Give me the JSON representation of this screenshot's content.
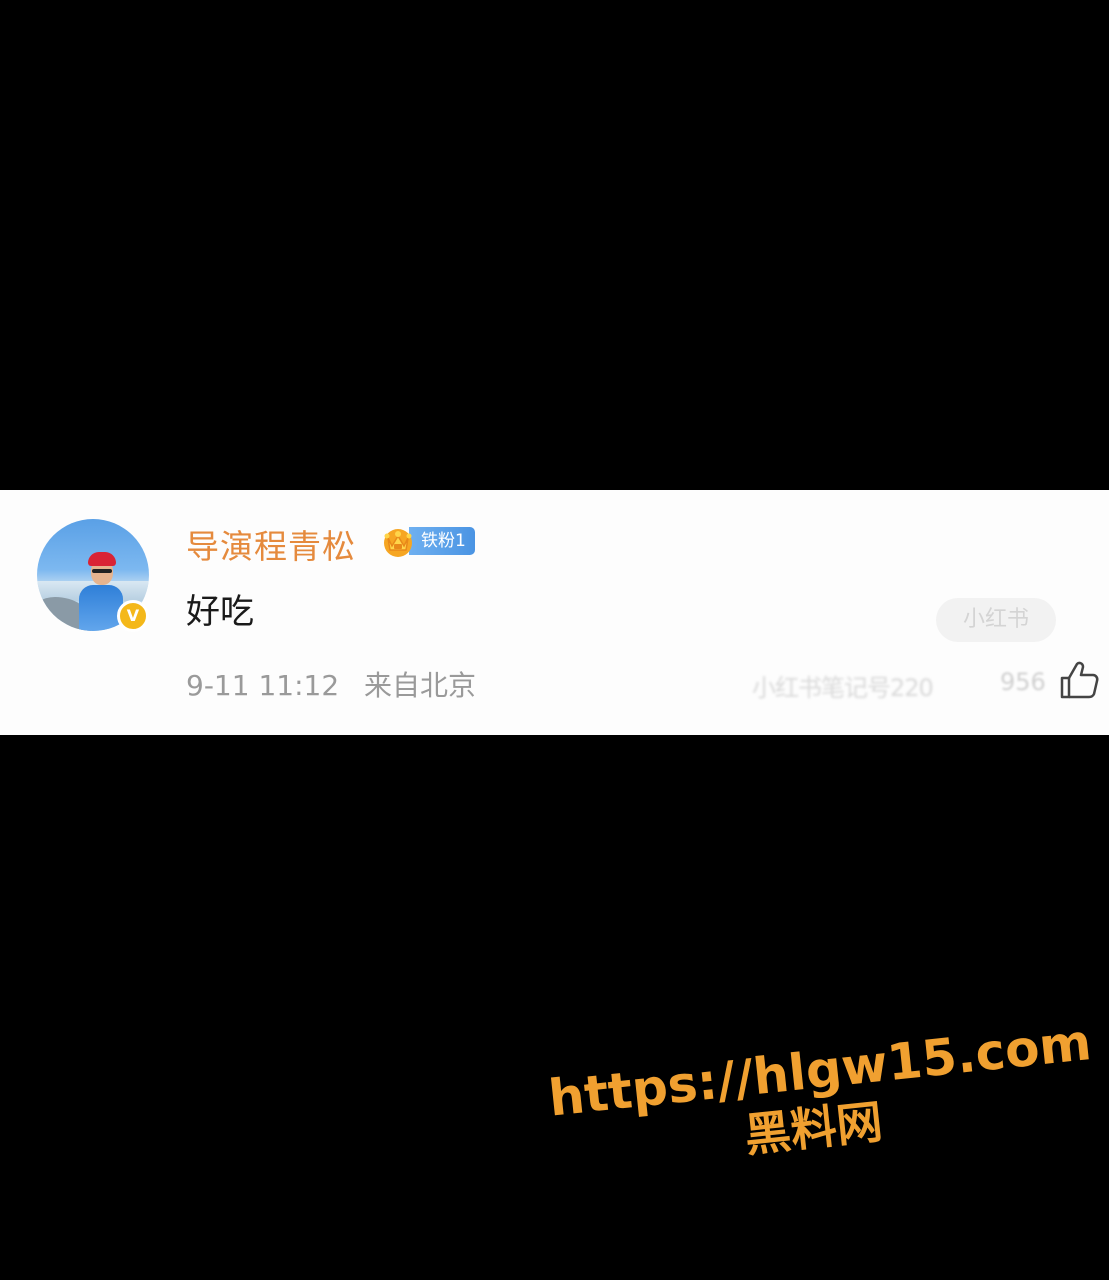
{
  "comment": {
    "username": "导演程青松",
    "fan_badge_label": "铁粉1",
    "text": "好吃",
    "date": "9-11 11:12",
    "location": "来自北京",
    "source_tag": "小红书",
    "right_text": "小红书笔记号220",
    "like_count": "956",
    "verified_mark": "V",
    "icons": [
      "verified-icon",
      "crown-icon",
      "thumb-up-icon"
    ],
    "colors": {
      "username": "#e58a3d",
      "badge": "#4a94e3",
      "verified": "#f4b81a"
    }
  },
  "watermark": {
    "url": "https://hlgw15.com",
    "site": "黑料网",
    "color": "#f0a030"
  }
}
